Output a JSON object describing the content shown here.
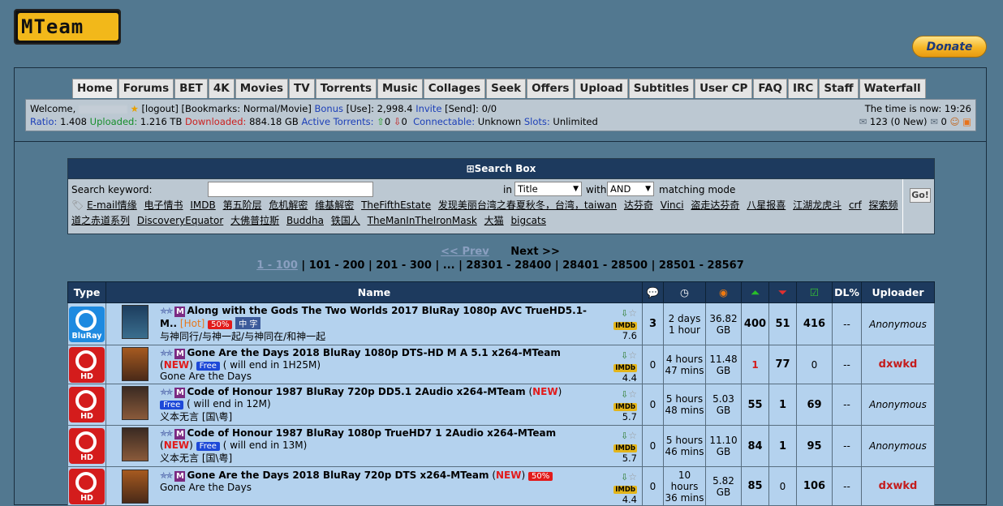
{
  "logo": {
    "text": "MTeam"
  },
  "donate": {
    "label": "Donate"
  },
  "nav": [
    "Home",
    "Forums",
    "BET",
    "4K",
    "Movies",
    "TV",
    "Torrents",
    "Music",
    "Collages",
    "Seek",
    "Offers",
    "Upload",
    "Subtitles",
    "User CP",
    "FAQ",
    "IRC",
    "Staff",
    "Waterfall"
  ],
  "user": {
    "welcome": "Welcome,",
    "logout": "[logout]",
    "bookmarks": "[Bookmarks: Normal/Movie]",
    "bonus_label": "Bonus",
    "use": "[Use]: 2,998.4",
    "invite_label": "Invite",
    "send": "[Send]: 0/0",
    "ratio_label": "Ratio:",
    "ratio": "1.408",
    "uploaded_label": "Uploaded:",
    "uploaded": "1.216 TB",
    "downloaded_label": "Downloaded:",
    "downloaded": "884.18 GB",
    "active_label": "Active Torrents:",
    "active_up": "0",
    "active_down": "0",
    "connectable_label": "Connectable:",
    "connectable": "Unknown",
    "slots_label": "Slots:",
    "slots": "Unlimited",
    "time": "The time is now: 19:26",
    "messages": "123 (0 New)",
    "count2": "0"
  },
  "search": {
    "header": "Search Box",
    "keyword_label": "Search keyword:",
    "in_label": "in",
    "in_value": "Title",
    "with_label": "with",
    "with_value": "AND",
    "mode_label": "matching mode",
    "go": "Go!",
    "keywords": [
      "E-mail情缘",
      "电子情书",
      "IMDB",
      "第五阶层",
      "危机解密",
      "维基解密",
      "TheFifthEstate",
      "发现美丽台湾之春夏秋冬，台湾，taiwan",
      "达芬奇",
      "Vinci",
      "盗走达芬奇",
      "八星报喜",
      "江湖龙虎斗",
      "crf",
      "探索频道之赤道系列",
      "DiscoveryEquator",
      "大佛普拉斯",
      "Buddha",
      "铁国人",
      "TheManInTheIronMask",
      "大猫",
      "bigcats"
    ]
  },
  "pager": {
    "prev": "<< Prev",
    "next": "Next >>",
    "current": "1 - 100",
    "pages": [
      "101 - 200",
      "201 - 300",
      "...",
      "28301 - 28400",
      "28401 - 28500",
      "28501 - 28567"
    ]
  },
  "table": {
    "headers": {
      "type": "Type",
      "name": "Name",
      "dl": "DL%",
      "uploader": "Uploader"
    },
    "rows": [
      {
        "type": "BluRay",
        "title": "Along with the Gods The Two Worlds 2017 BluRay 1080p AVC TrueHD5.1-M..",
        "tags": [
          "[Hot]",
          "50%",
          "中 字"
        ],
        "note": "",
        "subtitle": "与神同行/与神一起/与神同在/和神一起",
        "rating": "7.6",
        "comments": "3",
        "time": "2 days 1 hour",
        "size": "36.82 GB",
        "seeders": "400",
        "leechers": "51",
        "completed": "416",
        "dl": "--",
        "uploader": "Anonymous"
      },
      {
        "type": "HD",
        "title": "Gone Are the Days 2018 BluRay 1080p DTS-HD M A 5.1 x264-MTeam",
        "tags": [
          "NEW",
          "Free"
        ],
        "note": "( will end in 1H25M)",
        "subtitle": "Gone Are the Days",
        "rating": "4.4",
        "comments": "0",
        "time": "4 hours 47 mins",
        "size": "11.48 GB",
        "seeders": "1",
        "leechers": "77",
        "completed": "0",
        "dl": "--",
        "uploader": "dxwkd"
      },
      {
        "type": "HD",
        "title": "Code of Honour 1987 BluRay 720p DD5.1 2Audio x264-MTeam",
        "tags": [
          "NEW",
          "Free"
        ],
        "note": "( will end in 12M)",
        "subtitle": "义本无言 [国\\粤]",
        "rating": "5.7",
        "comments": "0",
        "time": "5 hours 48 mins",
        "size": "5.03 GB",
        "seeders": "55",
        "leechers": "1",
        "completed": "69",
        "dl": "--",
        "uploader": "Anonymous"
      },
      {
        "type": "HD",
        "title": "Code of Honour 1987 BluRay 1080p TrueHD7 1 2Audio x264-MTeam",
        "tags": [
          "NEW",
          "Free"
        ],
        "note": "( will end in 13M)",
        "subtitle": "义本无言 [国\\粤]",
        "rating": "5.7",
        "comments": "0",
        "time": "5 hours 46 mins",
        "size": "11.10 GB",
        "seeders": "84",
        "leechers": "1",
        "completed": "95",
        "dl": "--",
        "uploader": "Anonymous"
      },
      {
        "type": "HD",
        "title": "Gone Are the Days 2018 BluRay 720p DTS x264-MTeam",
        "tags": [
          "NEW",
          "50%"
        ],
        "note": "",
        "subtitle": "Gone Are the Days",
        "rating": "4.4",
        "comments": "0",
        "time": "10 hours 36 mins",
        "size": "5.82 GB",
        "seeders": "85",
        "leechers": "0",
        "completed": "106",
        "dl": "--",
        "uploader": "dxwkd"
      }
    ]
  }
}
